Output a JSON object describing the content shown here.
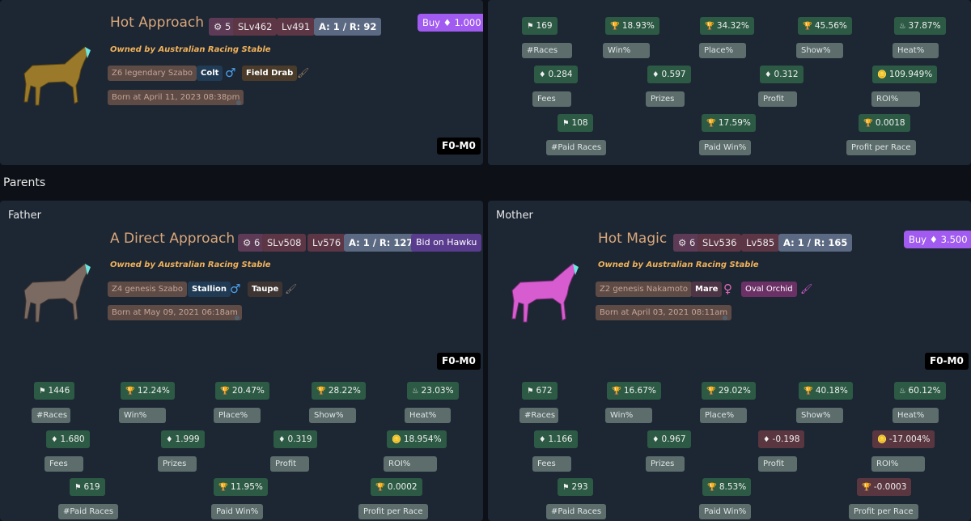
{
  "top": {
    "name": "Hot Approach",
    "gear": "5",
    "slv": "SLv462",
    "lv": "Lv491",
    "ar": "A: 1 / R: 92",
    "buy": "Buy ♦ 1.000",
    "owner": "Owned by Australian Racing Stable",
    "origin": "Z6 legendary Szabo",
    "type": "Colt",
    "gender": "♂",
    "color": "Field Drab",
    "born": "Born at April 11, 2023 08:38pm",
    "gen": "F0-M0",
    "coat_color": "#9a7a2a"
  },
  "top_stats": {
    "row1": [
      {
        "value": "169",
        "label": "#Races",
        "icon": "flag-icon"
      },
      {
        "value": "18.93%",
        "label": "Win%",
        "icon": "trophy-icon"
      },
      {
        "value": "34.32%",
        "label": "Place%",
        "icon": "trophy-icon"
      },
      {
        "value": "45.56%",
        "label": "Show%",
        "icon": "trophy-icon"
      },
      {
        "value": "37.87%",
        "label": "Heat%",
        "icon": "flame-icon"
      }
    ],
    "row2": [
      {
        "value": "0.284",
        "label": "Fees",
        "icon": "eth-icon"
      },
      {
        "value": "0.597",
        "label": "Prizes",
        "icon": "eth-icon"
      },
      {
        "value": "0.312",
        "label": "Profit",
        "icon": "eth-icon"
      },
      {
        "value": "109.949%",
        "label": "ROI%",
        "icon": "coins-icon"
      }
    ],
    "row3": [
      {
        "value": "108",
        "label": "#Paid Races",
        "icon": "flag-icon"
      },
      {
        "value": "17.59%",
        "label": "Paid Win%",
        "icon": "trophy-icon"
      },
      {
        "value": "0.0018",
        "label": "Profit per Race",
        "icon": "trophy-icon"
      }
    ]
  },
  "parents_title": "Parents",
  "father": {
    "label": "Father",
    "name": "A Direct Approach",
    "gear": "6",
    "slv": "SLv508",
    "lv": "Lv576",
    "ar": "A: 1 / R: 127",
    "action": "Bid on Hawku",
    "owner": "Owned by Australian Racing Stable",
    "origin": "Z4 genesis Szabo",
    "type": "Stallion",
    "gender": "♂",
    "color": "Taupe",
    "born": "Born at May 09, 2021 06:18am",
    "gen": "F0-M0",
    "coat_color": "#7a6a62",
    "stats": {
      "row1": [
        {
          "value": "1446",
          "label": "#Races"
        },
        {
          "value": "12.24%",
          "label": "Win%"
        },
        {
          "value": "20.47%",
          "label": "Place%"
        },
        {
          "value": "28.22%",
          "label": "Show%"
        },
        {
          "value": "23.03%",
          "label": "Heat%"
        }
      ],
      "row2": [
        {
          "value": "1.680",
          "label": "Fees"
        },
        {
          "value": "1.999",
          "label": "Prizes"
        },
        {
          "value": "0.319",
          "label": "Profit"
        },
        {
          "value": "18.954%",
          "label": "ROI%"
        }
      ],
      "row3": [
        {
          "value": "619",
          "label": "#Paid Races"
        },
        {
          "value": "11.95%",
          "label": "Paid Win%"
        },
        {
          "value": "0.0002",
          "label": "Profit per Race"
        }
      ]
    }
  },
  "mother": {
    "label": "Mother",
    "name": "Hot Magic",
    "gear": "6",
    "slv": "SLv536",
    "lv": "Lv585",
    "ar": "A: 1 / R: 165",
    "action": "Buy ♦ 3.500",
    "owner": "Owned by Australian Racing Stable",
    "origin": "Z2 genesis Nakamoto",
    "type": "Mare",
    "gender": "♀",
    "color": "Oval Orchid",
    "born": "Born at April 03, 2021 08:11am",
    "gen": "F0-M0",
    "coat_color": "#d65cd0",
    "stats": {
      "row1": [
        {
          "value": "672",
          "label": "#Races"
        },
        {
          "value": "16.67%",
          "label": "Win%"
        },
        {
          "value": "29.02%",
          "label": "Place%"
        },
        {
          "value": "40.18%",
          "label": "Show%"
        },
        {
          "value": "60.12%",
          "label": "Heat%"
        }
      ],
      "row2": [
        {
          "value": "1.166",
          "label": "Fees"
        },
        {
          "value": "0.967",
          "label": "Prizes"
        },
        {
          "value": "-0.198",
          "label": "Profit"
        },
        {
          "value": "-17.004%",
          "label": "ROI%"
        }
      ],
      "row3": [
        {
          "value": "293",
          "label": "#Paid Races"
        },
        {
          "value": "8.53%",
          "label": "Paid Win%"
        },
        {
          "value": "-0.0003",
          "label": "Profit per Race"
        }
      ]
    }
  }
}
